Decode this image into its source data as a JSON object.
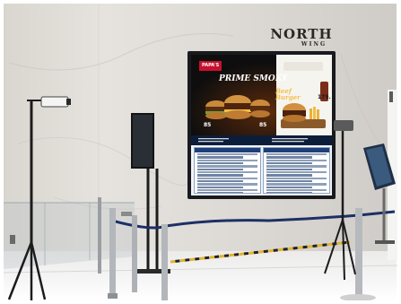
{
  "sign": {
    "title": "NORTH",
    "subtitle": "WING"
  },
  "promo": {
    "brand": "PAPA'S",
    "headline": "PRIME SMOKY",
    "feature": [
      "Beef",
      "Burger"
    ],
    "prices": [
      "179.",
      "85",
      "85"
    ]
  },
  "colors": {
    "wall": "#dcd9d4",
    "screen_bezel": "#181a1d",
    "promo_background": "#101010",
    "brand_red": "#c8102e",
    "directory_blue": "#1f3f7a",
    "rope": "#1d2f66",
    "floor_tape_yellow": "#e2b32c"
  }
}
